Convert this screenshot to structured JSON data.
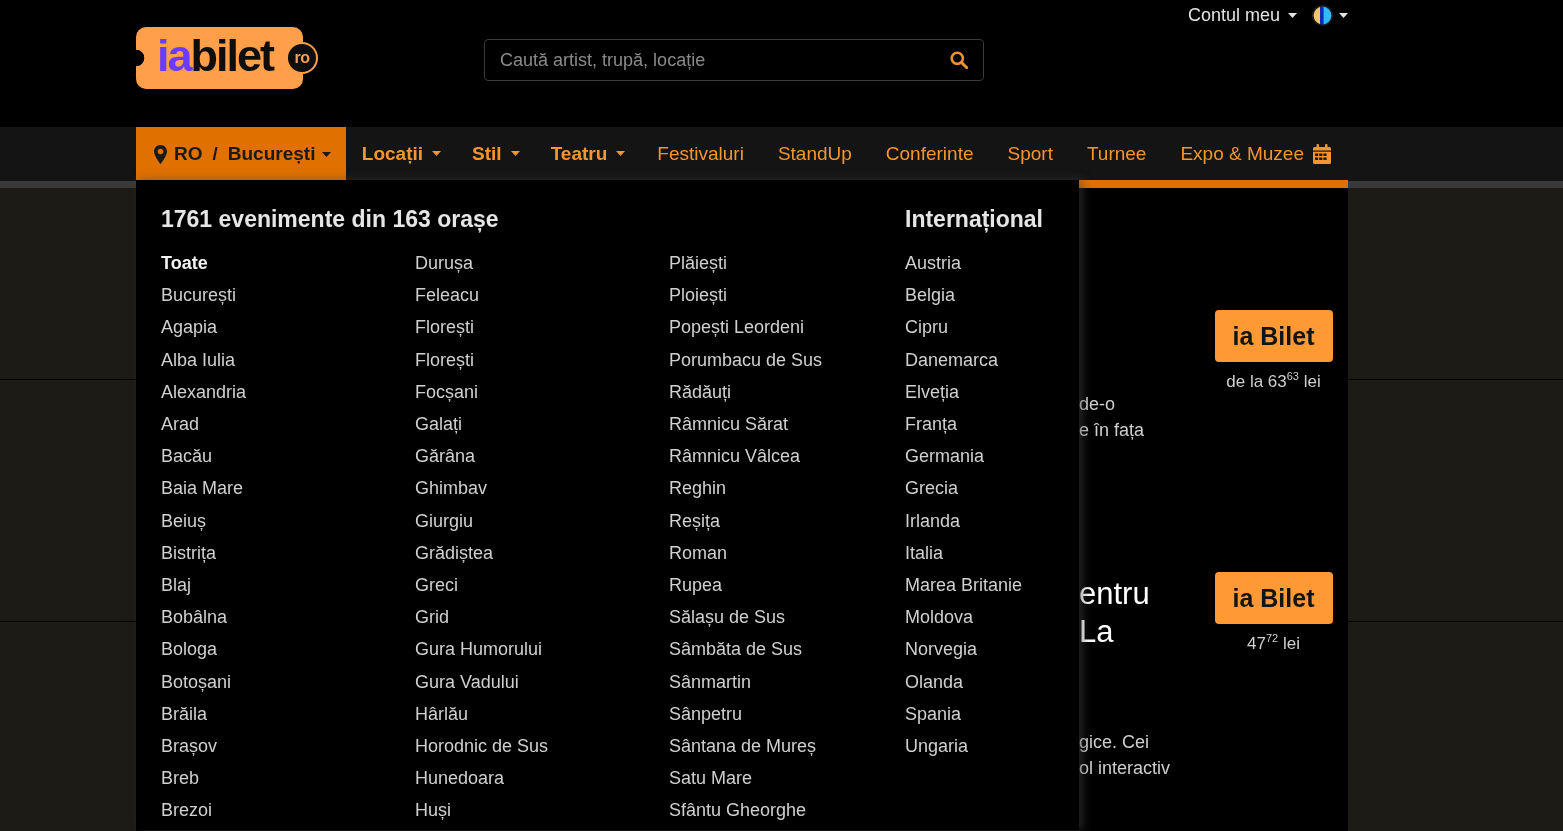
{
  "header": {
    "logo": {
      "prefix": "ia",
      "name": "bilet",
      "badge": "ro"
    },
    "search": {
      "placeholder": "Caută artist, trupă, locație"
    },
    "account": {
      "label": "Contul meu"
    }
  },
  "nav": {
    "location": {
      "country": "RO",
      "separator": "/",
      "city": "București",
      "expanded": true
    },
    "items": [
      {
        "label": "Locații",
        "kind": "dropdown"
      },
      {
        "label": "Stil",
        "kind": "dropdown"
      },
      {
        "label": "Teatru",
        "kind": "dropdown"
      },
      {
        "label": "Festivaluri",
        "kind": "link"
      },
      {
        "label": "StandUp",
        "kind": "link"
      },
      {
        "label": "Conferinte",
        "kind": "link"
      },
      {
        "label": "Sport",
        "kind": "link"
      },
      {
        "label": "Turnee",
        "kind": "link"
      },
      {
        "label": "Expo & Muzee",
        "kind": "calendar"
      }
    ]
  },
  "city_menu": {
    "title": "1761 evenimente din 163 orașe",
    "all_label": "Toate",
    "columns": [
      [
        "București",
        "Agapia",
        "Alba Iulia",
        "Alexandria",
        "Arad",
        "Bacău",
        "Baia Mare",
        "Beiuș",
        "Bistrița",
        "Blaj",
        "Bobâlna",
        "Bologa",
        "Botoșani",
        "Brăila",
        "Brașov",
        "Breb",
        "Brezoi"
      ],
      [
        "Durușa",
        "Feleacu",
        "Florești",
        "Florești",
        "Focșani",
        "Galați",
        "Gărâna",
        "Ghimbav",
        "Giurgiu",
        "Grădiștea",
        "Greci",
        "Grid",
        "Gura Humorului",
        "Gura Vadului",
        "Hârlău",
        "Horodnic de Sus",
        "Hunedoara",
        "Huși"
      ],
      [
        "Plăiești",
        "Ploiești",
        "Popești Leordeni",
        "Porumbacu de Sus",
        "Rădăuți",
        "Râmnicu Sărat",
        "Râmnicu Vâlcea",
        "Reghin",
        "Reșița",
        "Roman",
        "Rupea",
        "Sălașu de Sus",
        "Sâmbăta de Sus",
        "Sânmartin",
        "Sânpetru",
        "Sântana de Mureș",
        "Satu Mare",
        "Sfântu Gheorghe"
      ]
    ],
    "international": {
      "heading": "Internațional",
      "countries": [
        "Austria",
        "Belgia",
        "Cipru",
        "Danemarca",
        "Elveția",
        "Franța",
        "Germania",
        "Grecia",
        "Irlanda",
        "Italia",
        "Marea Britanie",
        "Moldova",
        "Norvegia",
        "Olanda",
        "Spania",
        "Ungaria"
      ]
    }
  },
  "events": [
    {
      "description_lines": [
        "de-o",
        "e în fața"
      ],
      "button": "ia Bilet",
      "price": "de la 63$^{63}$ lei"
    },
    {
      "title_lines": [
        "entru",
        "La"
      ],
      "description_lines": [
        "gice. Cei",
        "ol interactiv"
      ],
      "button": "ia Bilet",
      "price": "47$^{72}$ lei"
    }
  ]
}
